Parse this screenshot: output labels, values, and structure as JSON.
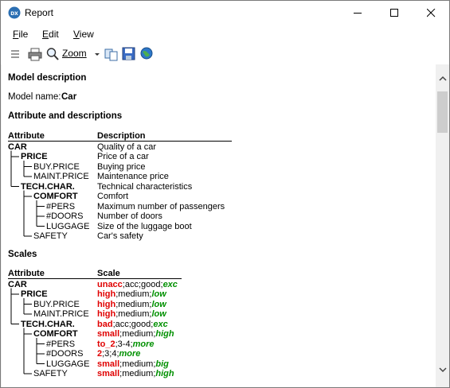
{
  "window": {
    "title": "Report"
  },
  "menu": [
    "File",
    "Edit",
    "View"
  ],
  "toolbar": {
    "zoom_label": "Zoom"
  },
  "model": {
    "heading": "Model description",
    "name_label": "Model name:",
    "name_value": "Car"
  },
  "attributes": {
    "heading": "Attribute and descriptions",
    "col_attribute": "Attribute",
    "col_description": "Description",
    "rows": [
      {
        "name": "CAR",
        "desc": "Quality of a car",
        "bold": true
      },
      {
        "name": "PRICE",
        "desc": "Price of a car",
        "bold": true
      },
      {
        "name": "BUY.PRICE",
        "desc": "Buying price",
        "bold": false
      },
      {
        "name": "MAINT.PRICE",
        "desc": "Maintenance price",
        "bold": false
      },
      {
        "name": "TECH.CHAR.",
        "desc": "Technical characteristics",
        "bold": true
      },
      {
        "name": "COMFORT",
        "desc": "Comfort",
        "bold": true
      },
      {
        "name": "#PERS",
        "desc": "Maximum number of passengers",
        "bold": false
      },
      {
        "name": "#DOORS",
        "desc": "Number of doors",
        "bold": false
      },
      {
        "name": "LUGGAGE",
        "desc": "Size of the luggage boot",
        "bold": false
      },
      {
        "name": "SAFETY",
        "desc": "Car's safety",
        "bold": false
      }
    ]
  },
  "scales": {
    "heading": "Scales",
    "col_attribute": "Attribute",
    "col_scale": "Scale",
    "rows": [
      {
        "name": "CAR",
        "bold": true,
        "values": [
          {
            "t": "unacc",
            "c": "bad"
          },
          {
            "t": ";acc;good;",
            "c": "n"
          },
          {
            "t": "exc",
            "c": "good"
          }
        ]
      },
      {
        "name": "PRICE",
        "bold": true,
        "values": [
          {
            "t": "high",
            "c": "bad"
          },
          {
            "t": ";medium;",
            "c": "n"
          },
          {
            "t": "low",
            "c": "good"
          }
        ]
      },
      {
        "name": "BUY.PRICE",
        "bold": false,
        "values": [
          {
            "t": "high",
            "c": "bad"
          },
          {
            "t": ";medium;",
            "c": "n"
          },
          {
            "t": "low",
            "c": "good"
          }
        ]
      },
      {
        "name": "MAINT.PRICE",
        "bold": false,
        "values": [
          {
            "t": "high",
            "c": "bad"
          },
          {
            "t": ";medium;",
            "c": "n"
          },
          {
            "t": "low",
            "c": "good"
          }
        ]
      },
      {
        "name": "TECH.CHAR.",
        "bold": true,
        "values": [
          {
            "t": "bad",
            "c": "bad"
          },
          {
            "t": ";acc;good;",
            "c": "n"
          },
          {
            "t": "exc",
            "c": "good"
          }
        ]
      },
      {
        "name": "COMFORT",
        "bold": true,
        "values": [
          {
            "t": "small",
            "c": "bad"
          },
          {
            "t": ";medium;",
            "c": "n"
          },
          {
            "t": "high",
            "c": "good"
          }
        ]
      },
      {
        "name": "#PERS",
        "bold": false,
        "values": [
          {
            "t": "to_2",
            "c": "bad"
          },
          {
            "t": ";3-4;",
            "c": "n"
          },
          {
            "t": "more",
            "c": "good"
          }
        ]
      },
      {
        "name": "#DOORS",
        "bold": false,
        "values": [
          {
            "t": "2",
            "c": "bad"
          },
          {
            "t": ";3;4;",
            "c": "n"
          },
          {
            "t": "more",
            "c": "good"
          }
        ]
      },
      {
        "name": "LUGGAGE",
        "bold": false,
        "values": [
          {
            "t": "small",
            "c": "bad"
          },
          {
            "t": ";medium;",
            "c": "n"
          },
          {
            "t": "big",
            "c": "good"
          }
        ]
      },
      {
        "name": "SAFETY",
        "bold": false,
        "values": [
          {
            "t": "small",
            "c": "bad"
          },
          {
            "t": ";medium;",
            "c": "n"
          },
          {
            "t": "high",
            "c": "good"
          }
        ]
      }
    ]
  },
  "colors": {
    "bad": "#e00000",
    "good": "#009000"
  }
}
